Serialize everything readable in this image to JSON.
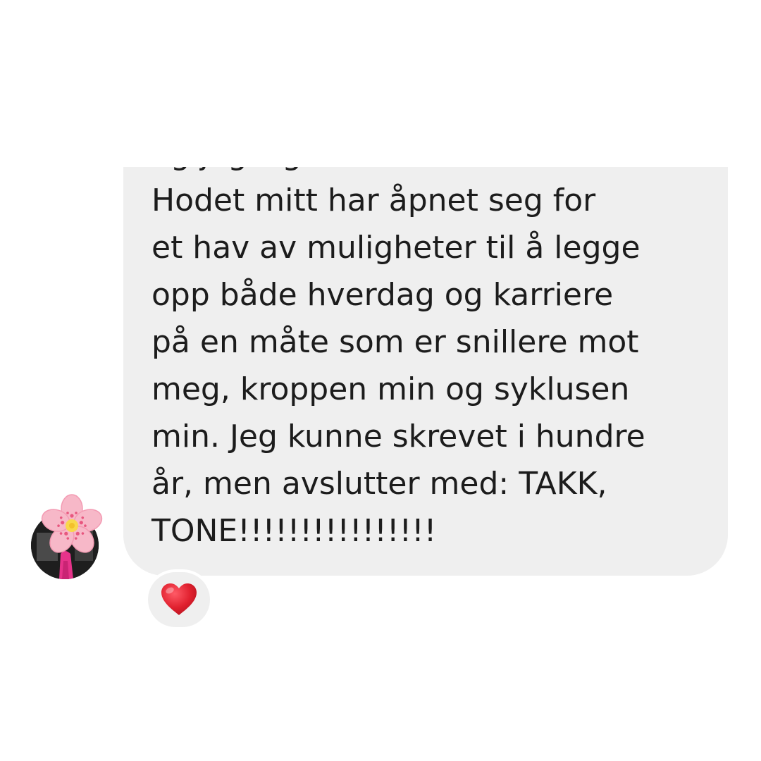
{
  "message": {
    "cut_off_line": "og jeg sig",
    "lines": [
      "Hodet mitt har åpnet seg for",
      "et hav av muligheter til å legge",
      "opp både hverdag og karriere",
      "på en måte som er snillere mot",
      "meg, kroppen min og syklusen",
      "min. Jeg kunne skrevet i hundre",
      "år, men avslutter med: TAKK,",
      "TONE!!!!!!!!!!!!!!!!"
    ]
  },
  "reaction": {
    "icon": "heart-icon",
    "color": "#e0202e"
  },
  "avatar": {
    "icon": "flower-sticker-icon",
    "flower_color": "#f7b8c8",
    "center_color": "#f9d84a"
  },
  "colors": {
    "bubble": "#efefef",
    "text": "#1c1c1c",
    "background": "#ffffff"
  }
}
